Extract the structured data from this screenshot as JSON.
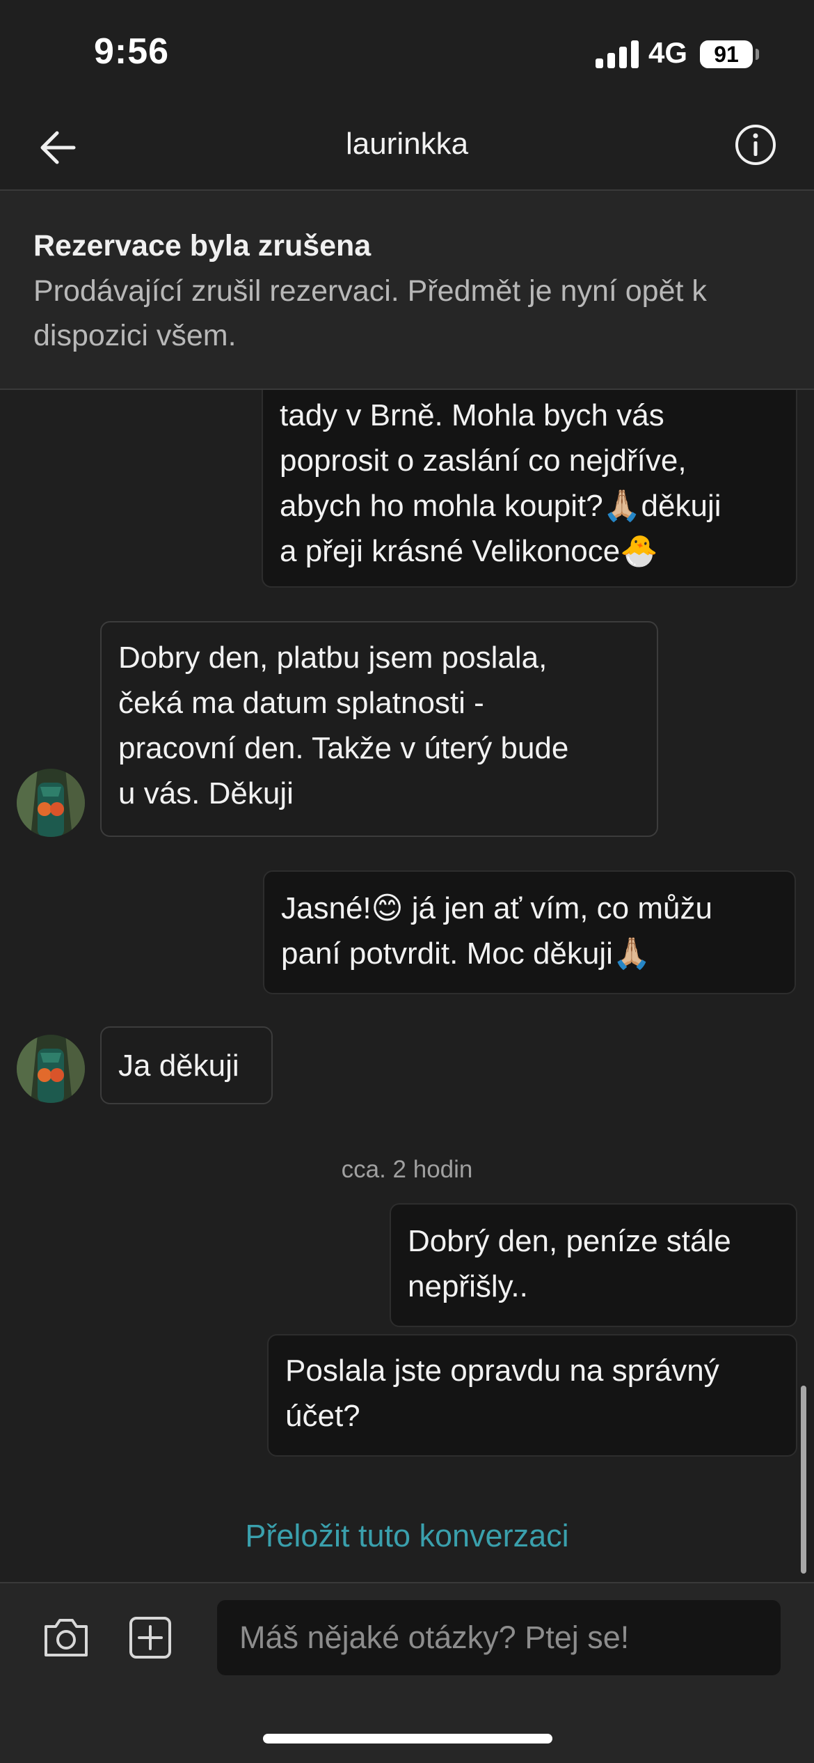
{
  "status_bar": {
    "time": "9:56",
    "network": "4G",
    "battery": "91"
  },
  "header": {
    "title": "laurinkka",
    "back_icon": "arrow-left-icon",
    "info_icon": "info-circle-icon"
  },
  "banner": {
    "title": "Rezervace byla zrušena",
    "text": "Prodávající zrušil rezervaci. Předmět je nyní opět k dispozici všem."
  },
  "messages": [
    {
      "direction": "outgoing",
      "lines": [
        "tady v Brně. Mohla bych vás",
        "poprosit o zaslání co nejdříve,",
        "abych ho mohla koupit?🙏🏼děkuji",
        "a přeji krásné Velikonoce🐣"
      ]
    },
    {
      "direction": "incoming",
      "lines": [
        "Dobry den, platbu jsem poslala,",
        "čeká ma datum splatnosti -",
        "pracovní den. Takže v úterý bude",
        "u vás. Děkuji"
      ]
    },
    {
      "direction": "outgoing",
      "lines": [
        "Jasné!😊 já jen ať vím, co můžu",
        "paní potvrdit. Moc děkuji🙏🏼"
      ]
    },
    {
      "direction": "incoming",
      "lines": [
        "Ja děkuji"
      ]
    },
    {
      "direction": "outgoing",
      "lines": [
        "Dobrý den, peníze stále",
        "nepřišly.."
      ]
    },
    {
      "direction": "outgoing",
      "lines": [
        "Poslala jste opravdu na správný",
        "účet?"
      ]
    }
  ],
  "timestamp": "cca. 2 hodin",
  "translate_link": "Přeložit tuto konverzaci",
  "input": {
    "placeholder": "Máš nějaké otázky? Ptej se!",
    "camera_icon": "camera-icon",
    "add_icon": "plus-square-icon"
  },
  "colors": {
    "background": "#1f1f1f",
    "banner": "#262626",
    "outgoing_bubble": "#141414",
    "link": "#3aa0ad"
  }
}
